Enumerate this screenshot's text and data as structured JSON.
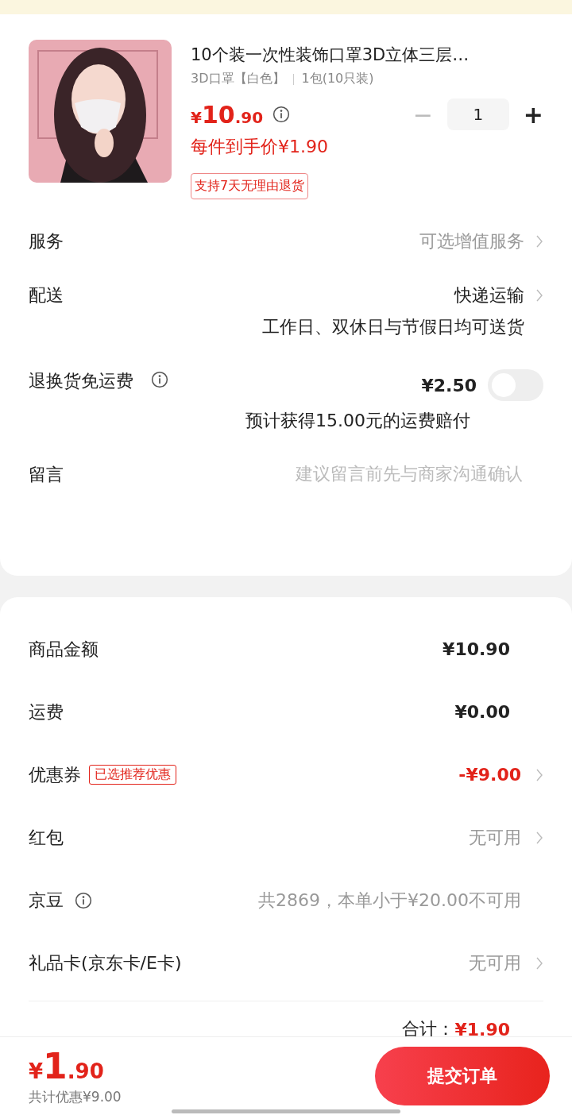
{
  "product": {
    "title": "10个装一次性装饰口罩3D立体三层…",
    "spec": "3D口罩【白色】",
    "pack": "1包(10只装)",
    "price_symbol": "¥",
    "price_int": "10",
    "price_dec": ".90",
    "unit_price": "每件到手价¥1.90",
    "quantity": "1",
    "minus": "−",
    "plus": "+",
    "tag": "支持7天无理由退货"
  },
  "options": [
    {
      "kind": "link",
      "label": "服务",
      "value": "可选增值服务",
      "muted": true
    },
    {
      "kind": "link",
      "label": "配送",
      "value": "快递运输",
      "note": "工作日、双休日与节假日均可送货",
      "muted": false
    },
    {
      "kind": "switch",
      "label": "退换货免运费",
      "value": "¥2.50",
      "note": "预计获得15.00元的运费赔付",
      "on": false
    },
    {
      "kind": "input",
      "label": "留言",
      "placeholder": "建议留言前先与商家沟通确认"
    }
  ],
  "summary": [
    {
      "kind": "amount",
      "label": "商品金额",
      "value": "¥10.90"
    },
    {
      "kind": "amount",
      "label": "运费",
      "value": "¥0.00"
    },
    {
      "kind": "discount",
      "label": "优惠券",
      "tag": "已选推荐优惠",
      "value": "-¥9.00"
    },
    {
      "kind": "option",
      "label": "红包",
      "value": "无可用"
    },
    {
      "kind": "note",
      "label": "京豆",
      "value": "共2869，本单小于¥20.00不可用"
    },
    {
      "kind": "option",
      "label": "礼品卡(京东卡/E卡)",
      "value": "无可用"
    }
  ],
  "total": {
    "label": "合计：",
    "value": "¥1.90"
  },
  "footer": {
    "price_symbol": "¥",
    "price_int": "1",
    "price_dec": ".90",
    "saving": "共计优惠¥9.00",
    "submit": "提交订单"
  }
}
